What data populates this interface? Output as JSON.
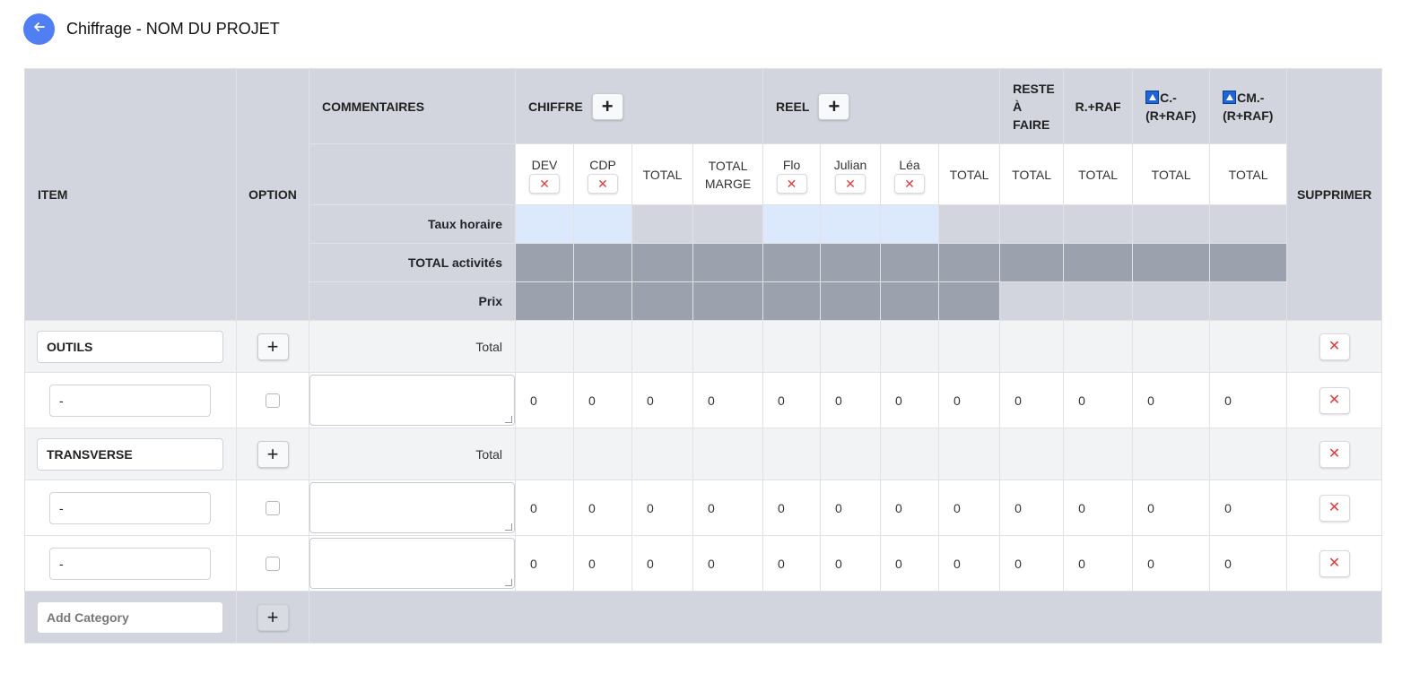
{
  "page": {
    "title": "Chiffrage - NOM DU PROJET"
  },
  "header": {
    "item": "ITEM",
    "option": "OPTION",
    "commentaires": "COMMENTAIRES",
    "chiffre": "CHIFFRE",
    "reel": "REEL",
    "reste_a_faire": [
      "RESTE",
      "À",
      "FAIRE"
    ],
    "r_raf": "R.+RAF",
    "c_raf": [
      "C.-",
      "(R+RAF)"
    ],
    "cm_raf": [
      "CM.-",
      "(R+RAF)"
    ],
    "supprimer": "SUPPRIMER"
  },
  "subheader": {
    "dev": "DEV",
    "cdp": "CDP",
    "total": "TOTAL",
    "total_marge": [
      "TOTAL",
      "MARGE"
    ],
    "flo": "Flo",
    "julian": "Julian",
    "lea": "Léa",
    "remove_symbol": "✕"
  },
  "summary_rows": {
    "taux_horaire": "Taux horaire",
    "total_activites": "TOTAL activités",
    "prix": "Prix"
  },
  "categories": [
    {
      "name": "OUTILS",
      "total_label": "Total",
      "items": [
        {
          "name": "-",
          "values": [
            "0",
            "0",
            "0",
            "0",
            "0",
            "0",
            "0",
            "0",
            "0",
            "0",
            "0",
            "0"
          ]
        }
      ]
    },
    {
      "name": "TRANSVERSE",
      "total_label": "Total",
      "items": [
        {
          "name": "-",
          "values": [
            "0",
            "0",
            "0",
            "0",
            "0",
            "0",
            "0",
            "0",
            "0",
            "0",
            "0",
            "0"
          ]
        },
        {
          "name": "-",
          "values": [
            "0",
            "0",
            "0",
            "0",
            "0",
            "0",
            "0",
            "0",
            "0",
            "0",
            "0",
            "0"
          ]
        }
      ]
    }
  ],
  "add_category": {
    "placeholder": "Add Category"
  },
  "icons": {
    "back": "arrow-left-icon",
    "plus": "plus-icon",
    "close": "close-icon",
    "sort": "sort-icon"
  },
  "colors": {
    "accent": "#4f7ff2",
    "header_bg": "#d2d5dd",
    "dark_cell": "#9ca1ae",
    "rate_cell": "#dce8fb",
    "danger": "#e23b3b"
  }
}
